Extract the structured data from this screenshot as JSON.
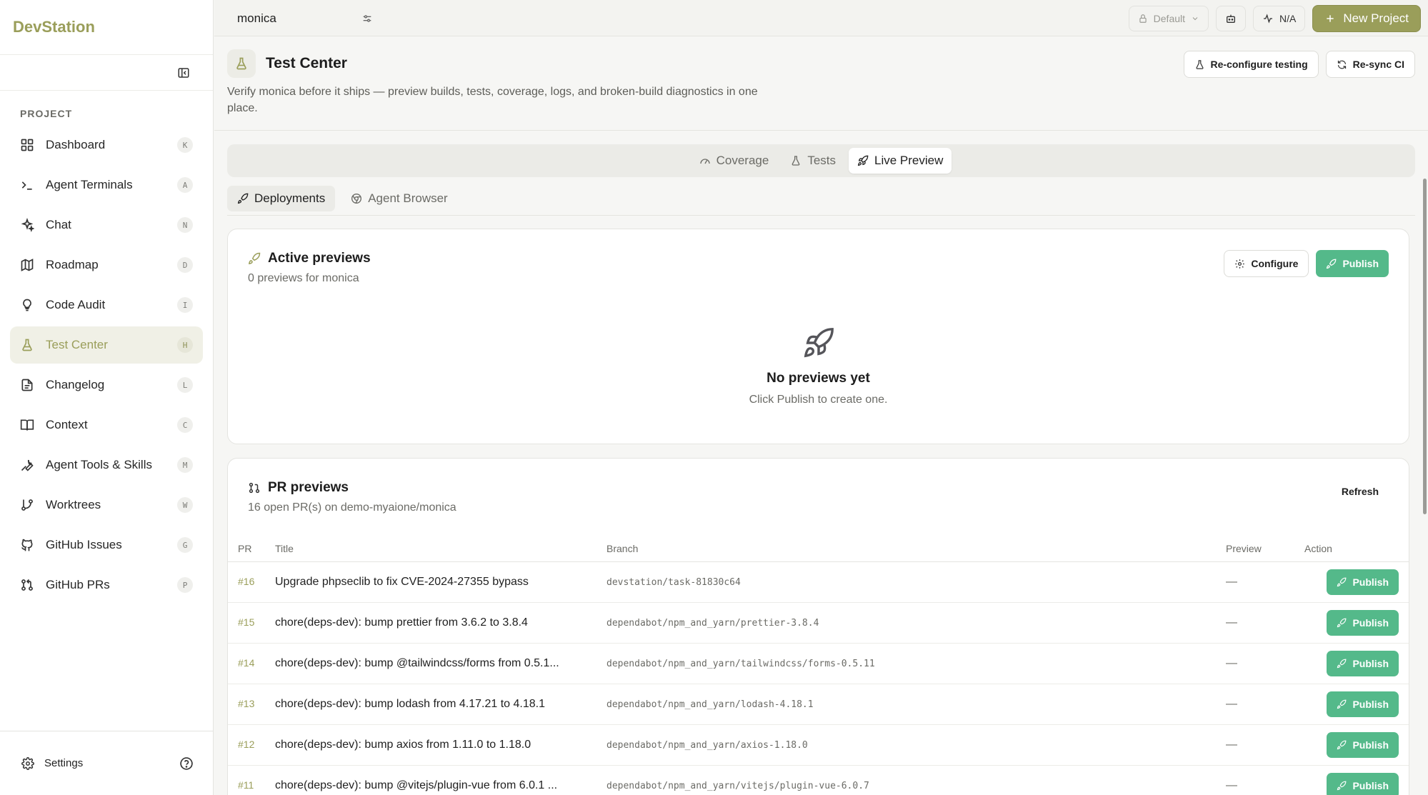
{
  "app": {
    "brand": "DevStation"
  },
  "sidebar": {
    "section_label": "PROJECT",
    "items": [
      {
        "label": "Dashboard",
        "key": "K",
        "icon": "grid-icon"
      },
      {
        "label": "Agent Terminals",
        "key": "A",
        "icon": "terminal-icon"
      },
      {
        "label": "Chat",
        "key": "N",
        "icon": "sparkles-icon"
      },
      {
        "label": "Roadmap",
        "key": "D",
        "icon": "map-icon"
      },
      {
        "label": "Code Audit",
        "key": "I",
        "icon": "lightbulb-icon"
      },
      {
        "label": "Test Center",
        "key": "H",
        "icon": "flask-icon",
        "active": true
      },
      {
        "label": "Changelog",
        "key": "L",
        "icon": "file-text-icon"
      },
      {
        "label": "Context",
        "key": "C",
        "icon": "book-icon"
      },
      {
        "label": "Agent Tools & Skills",
        "key": "M",
        "icon": "wrench-icon"
      },
      {
        "label": "Worktrees",
        "key": "W",
        "icon": "git-branch-icon"
      },
      {
        "label": "GitHub Issues",
        "key": "G",
        "icon": "github-icon"
      },
      {
        "label": "GitHub PRs",
        "key": "P",
        "icon": "git-pull-request-icon"
      }
    ],
    "footer": {
      "settings_label": "Settings"
    }
  },
  "topbar": {
    "project_tab": "monica",
    "profile_chip": "Default",
    "status_chip": "N/A",
    "new_project_label": "New Project"
  },
  "header": {
    "title": "Test Center",
    "description": "Verify monica before it ships — preview builds, tests, coverage, logs, and broken-build diagnostics in one place.",
    "reconfigure_label": "Re-configure testing",
    "resync_label": "Re-sync CI"
  },
  "tabs": {
    "coverage": "Coverage",
    "tests": "Tests",
    "live_preview": "Live Preview"
  },
  "subtabs": {
    "deployments": "Deployments",
    "agent_browser": "Agent Browser"
  },
  "active_previews": {
    "title": "Active previews",
    "subtitle": "0 previews for monica",
    "configure_label": "Configure",
    "publish_label": "Publish",
    "empty_title": "No previews yet",
    "empty_sub": "Click Publish to create one."
  },
  "pr_previews": {
    "title": "PR previews",
    "subtitle": "16 open PR(s) on demo-myaione/monica",
    "refresh_label": "Refresh",
    "columns": {
      "pr": "PR",
      "title": "Title",
      "branch": "Branch",
      "preview": "Preview",
      "action": "Action"
    },
    "rows": [
      {
        "num": "#16",
        "title": "Upgrade phpseclib to fix CVE-2024-27355 bypass",
        "branch": "devstation/task-81830c64",
        "preview": "—",
        "action": "Publish"
      },
      {
        "num": "#15",
        "title": "chore(deps-dev): bump prettier from 3.6.2 to 3.8.4",
        "branch": "dependabot/npm_and_yarn/prettier-3.8.4",
        "preview": "—",
        "action": "Publish"
      },
      {
        "num": "#14",
        "title": "chore(deps-dev): bump @tailwindcss/forms from 0.5.1...",
        "branch": "dependabot/npm_and_yarn/tailwindcss/forms-0.5.11",
        "preview": "—",
        "action": "Publish"
      },
      {
        "num": "#13",
        "title": "chore(deps-dev): bump lodash from 4.17.21 to 4.18.1",
        "branch": "dependabot/npm_and_yarn/lodash-4.18.1",
        "preview": "—",
        "action": "Publish"
      },
      {
        "num": "#12",
        "title": "chore(deps-dev): bump axios from 1.11.0 to 1.18.0",
        "branch": "dependabot/npm_and_yarn/axios-1.18.0",
        "preview": "—",
        "action": "Publish"
      },
      {
        "num": "#11",
        "title": "chore(deps-dev): bump @vitejs/plugin-vue from 6.0.1 ...",
        "branch": "dependabot/npm_and_yarn/vitejs/plugin-vue-6.0.7",
        "preview": "—",
        "action": "Publish"
      }
    ]
  },
  "colors": {
    "accent": "#9a9e5a",
    "publish": "#54b98a",
    "active_nav_bg": "#f0f0e6"
  }
}
